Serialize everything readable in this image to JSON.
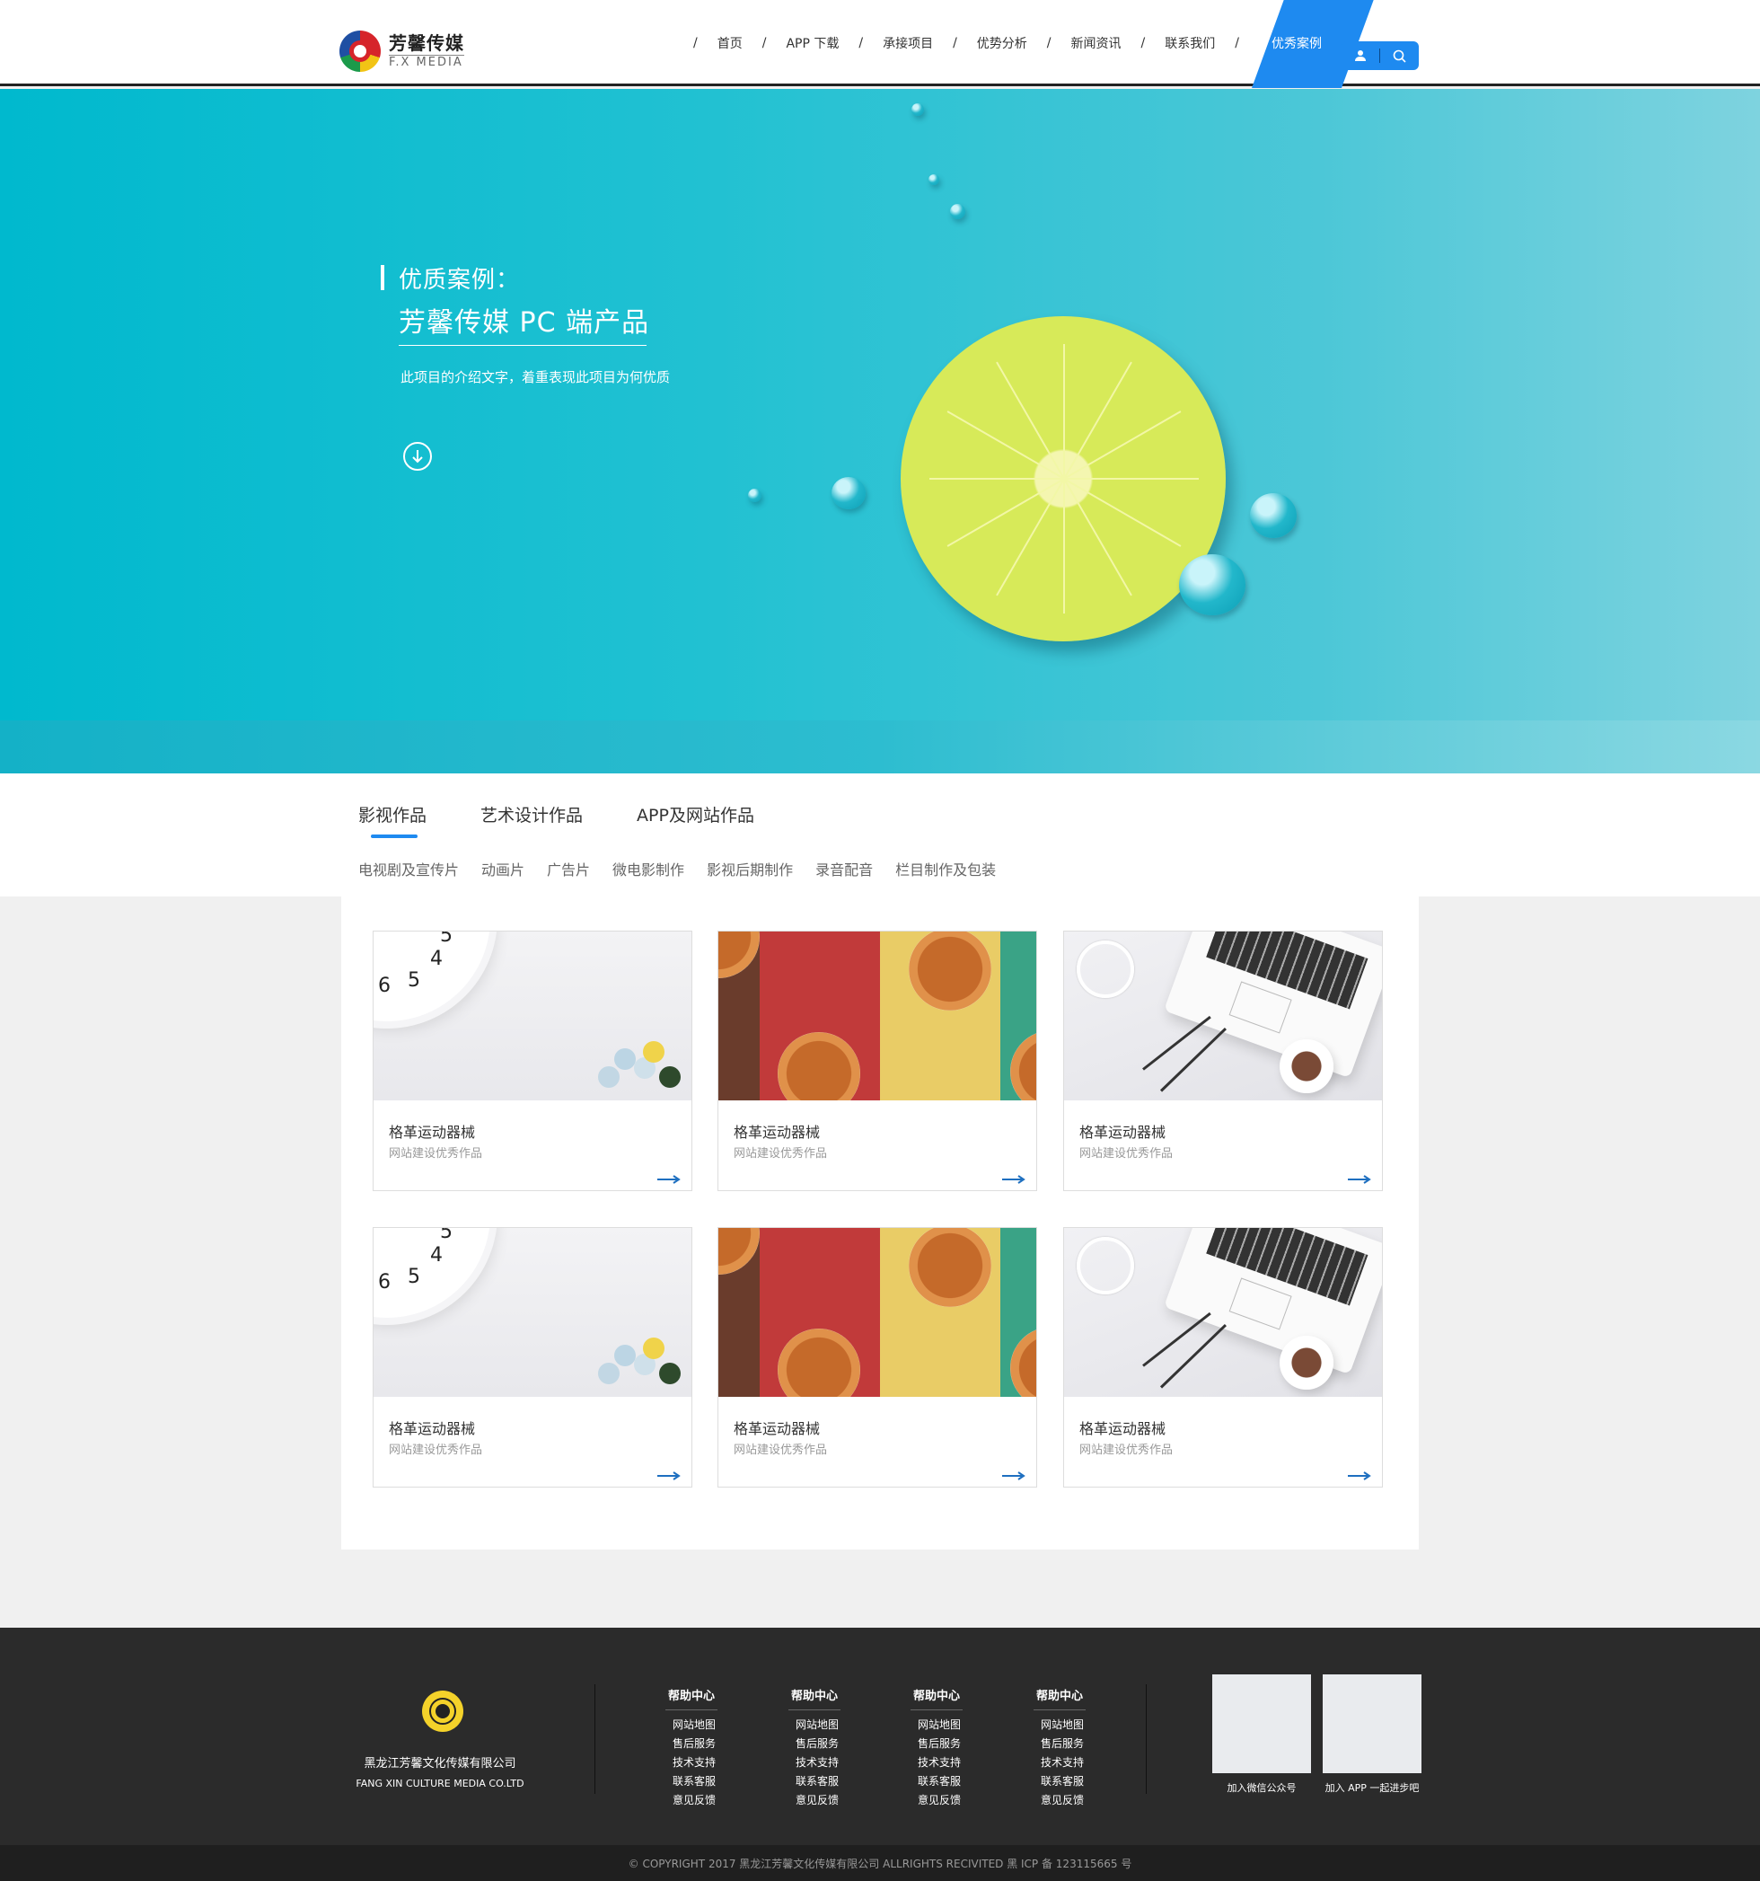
{
  "brand": {
    "name_cn": "芳馨传媒",
    "name_en": "F.X MEDIA"
  },
  "nav": {
    "items": [
      "首页",
      "APP 下载",
      "承接项目",
      "优势分析",
      "新闻资讯",
      "联系我们"
    ],
    "active": "优秀案例",
    "separator": "/"
  },
  "icons": {
    "user": "user-icon",
    "search": "search-icon",
    "down": "arrow-down-circle-icon",
    "card_arrow": "arrow-right-icon"
  },
  "colors": {
    "accent": "#1e8af0",
    "hero": "#00b9ce",
    "footer": "#2b2b2b"
  },
  "hero": {
    "title_line1": "优质案例：",
    "title_line2": "芳馨传媒 PC 端产品",
    "description": "此项目的介绍文字，着重表现此项目为何优质"
  },
  "tabs": {
    "items": [
      "影视作品",
      "艺术设计作品",
      "APP及网站作品"
    ],
    "active_index": 0,
    "subtabs": [
      "电视剧及宣传片",
      "动画片",
      "广告片",
      "微电影制作",
      "影视后期制作",
      "录音配音",
      "栏目制作及包装"
    ]
  },
  "cards": [
    {
      "title": "格革运动器械",
      "subtitle": "网站建设优秀作品",
      "image": "clock"
    },
    {
      "title": "格革运动器械",
      "subtitle": "网站建设优秀作品",
      "image": "cakes"
    },
    {
      "title": "格革运动器械",
      "subtitle": "网站建设优秀作品",
      "image": "laptop"
    },
    {
      "title": "格革运动器械",
      "subtitle": "网站建设优秀作品",
      "image": "clock"
    },
    {
      "title": "格革运动器械",
      "subtitle": "网站建设优秀作品",
      "image": "cakes"
    },
    {
      "title": "格革运动器械",
      "subtitle": "网站建设优秀作品",
      "image": "laptop"
    }
  ],
  "clock_numbers": [
    "5",
    "4",
    "6",
    "5"
  ],
  "footer": {
    "company_cn": "黑龙江芳馨文化传媒有限公司",
    "company_en": "FANG XIN CULTURE MEDIA CO.LTD",
    "columns": [
      {
        "heading": "帮助中心",
        "links": [
          "网站地图",
          "售后服务",
          "技术支持",
          "联系客服",
          "意见反馈"
        ]
      },
      {
        "heading": "帮助中心",
        "links": [
          "网站地图",
          "售后服务",
          "技术支持",
          "联系客服",
          "意见反馈"
        ]
      },
      {
        "heading": "帮助中心",
        "links": [
          "网站地图",
          "售后服务",
          "技术支持",
          "联系客服",
          "意见反馈"
        ]
      },
      {
        "heading": "帮助中心",
        "links": [
          "网站地图",
          "售后服务",
          "技术支持",
          "联系客服",
          "意见反馈"
        ]
      }
    ],
    "qr_wechat_label": "加入微信公众号",
    "qr_app_label": "加入 APP 一起进步吧",
    "copyright": "© COPYRIGHT 2017 黑龙江芳馨文化传媒有限公司 ALLRIGHTS RECIVITED 黑 ICP 备 123115665 号"
  }
}
